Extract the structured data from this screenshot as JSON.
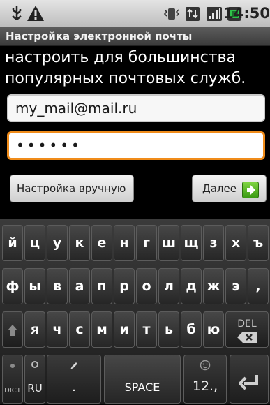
{
  "status_bar": {
    "icons": [
      "usb-icon",
      "warning-icon",
      "vibrate-icon",
      "data-transfer-icon",
      "signal-icon",
      "battery-icon"
    ],
    "time": "14:50"
  },
  "title": "Настройка электронной почты",
  "intro_lines": [
    "настроить для большинства",
    "популярных почтовых служб."
  ],
  "email_field": {
    "value": "my_mail@mail.ru"
  },
  "password_field": {
    "value": "••••••"
  },
  "buttons": {
    "manual": "Настройка вручную",
    "next": "Далее"
  },
  "keyboard": {
    "row1": [
      "й",
      "ц",
      "у",
      "к",
      "е",
      "н",
      "г",
      "ш",
      "щ",
      "з",
      "х",
      "ъ"
    ],
    "row2": [
      "ф",
      "ы",
      "в",
      "а",
      "п",
      "р",
      "о",
      "л",
      "д",
      "ж",
      "э",
      ","
    ],
    "row3": [
      "я",
      "ч",
      "с",
      "м",
      "и",
      "т",
      "ь",
      "б",
      "ю"
    ],
    "delete_label": "DEL",
    "dict_label": "DICT",
    "lang_label": "RU",
    "period_label": ".",
    "space_label": "SPACE",
    "numbers_label": "12.,"
  },
  "colors": {
    "focus_border": "#f08c1a",
    "next_arrow": "#4caf1c"
  }
}
